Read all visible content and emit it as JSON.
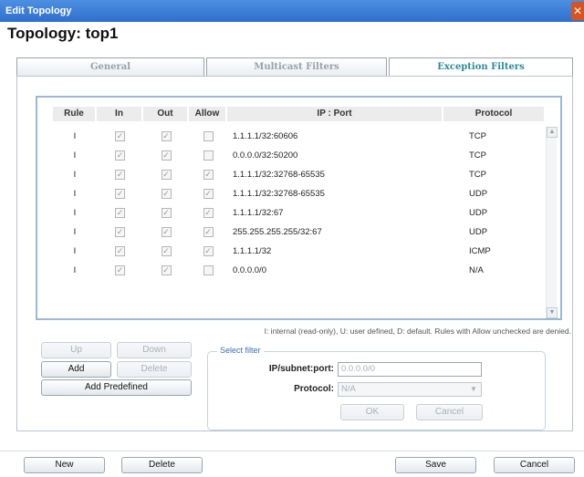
{
  "window": {
    "title": "Edit Topology",
    "close_glyph": "✕"
  },
  "page": {
    "title": "Topology: top1"
  },
  "tabs": [
    {
      "label": "General"
    },
    {
      "label": "Multicast Filters"
    },
    {
      "label": "Exception Filters"
    }
  ],
  "table": {
    "headers": {
      "rule": "Rule",
      "in": "In",
      "out": "Out",
      "allow": "Allow",
      "ip": "IP : Port",
      "protocol": "Protocol"
    },
    "rows": [
      {
        "rule": "I",
        "in": true,
        "out": true,
        "allow": false,
        "ip": "1.1.1.1/32:60606",
        "protocol": "TCP"
      },
      {
        "rule": "I",
        "in": true,
        "out": true,
        "allow": false,
        "ip": "0.0.0.0/32:50200",
        "protocol": "TCP"
      },
      {
        "rule": "I",
        "in": true,
        "out": true,
        "allow": true,
        "ip": "1.1.1.1/32:32768-65535",
        "protocol": "TCP"
      },
      {
        "rule": "I",
        "in": true,
        "out": true,
        "allow": true,
        "ip": "1.1.1.1/32:32768-65535",
        "protocol": "UDP"
      },
      {
        "rule": "I",
        "in": true,
        "out": true,
        "allow": true,
        "ip": "1.1.1.1/32:67",
        "protocol": "UDP"
      },
      {
        "rule": "I",
        "in": true,
        "out": true,
        "allow": true,
        "ip": "255.255.255.255/32:67",
        "protocol": "UDP"
      },
      {
        "rule": "I",
        "in": true,
        "out": true,
        "allow": true,
        "ip": "1.1.1.1/32",
        "protocol": "ICMP"
      },
      {
        "rule": "I",
        "in": true,
        "out": true,
        "allow": false,
        "ip": "0.0.0.0/0",
        "protocol": "N/A"
      }
    ]
  },
  "legend": "I: internal (read-only), U: user defined, D: default. Rules with Allow unchecked are denied.",
  "rule_buttons": {
    "up": "Up",
    "down": "Down",
    "add": "Add",
    "delete": "Delete",
    "add_predefined": "Add Predefined"
  },
  "filter": {
    "legend": "Select filter",
    "ip_label": "IP/subnet:port:",
    "ip_value": "0.0.0.0/0",
    "protocol_label": "Protocol:",
    "protocol_value": "N/A",
    "ok": "OK",
    "cancel": "Cancel"
  },
  "footer": {
    "new": "New",
    "delete": "Delete",
    "save": "Save",
    "cancel": "Cancel"
  },
  "icons": {
    "check": "✓",
    "scroll_up": "▲",
    "scroll_down": "▼",
    "caret": "▼"
  }
}
